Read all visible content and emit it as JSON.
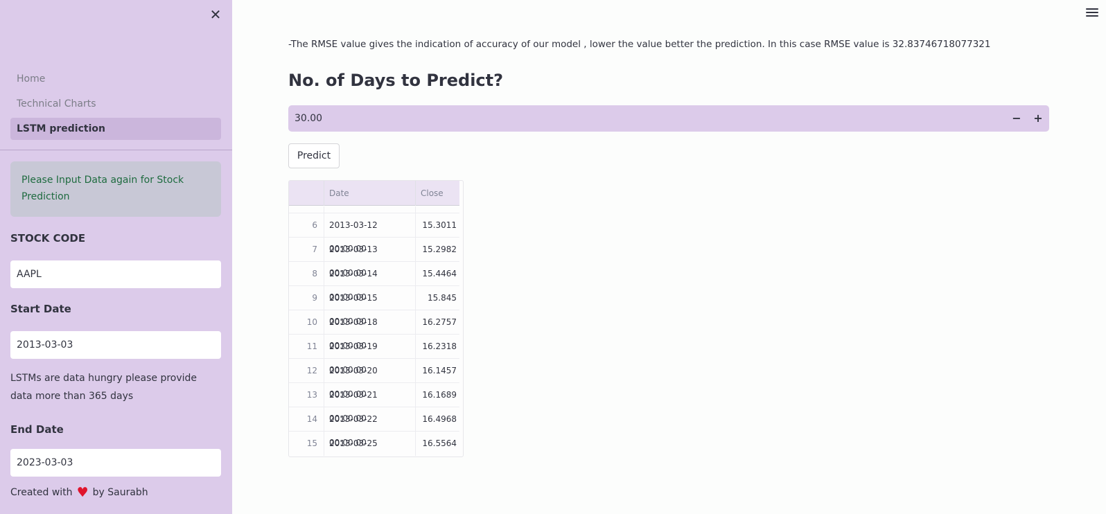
{
  "sidebar": {
    "close_glyph": "✕",
    "nav": [
      "Home",
      "Technical Charts",
      "LSTM prediction"
    ],
    "active_nav": "LSTM prediction",
    "info_message": "Please Input Data again for Stock Prediction",
    "stock_code_label": "STOCK CODE",
    "stock_code_value": "AAPL",
    "start_date_label": "Start Date",
    "start_date_value": "2013-03-03",
    "hint_text": "LSTMs are data hungry please provide data more than 365 days",
    "end_date_label": "End Date",
    "end_date_value": "2023-03-03",
    "credit_prefix": "Created with",
    "credit_suffix": "by Saurabh",
    "credit_icon": "heart-icon"
  },
  "main": {
    "rmse_text": "-The RMSE value gives the indication of accuracy of our model , lower the value better the prediction. In this case RMSE value is 32.83746718077321",
    "heading": "No. of Days to Predict?",
    "days_value": "30.00",
    "minus_glyph": "−",
    "plus_glyph": "+",
    "predict_label": "Predict",
    "table": {
      "columns": [
        "Date",
        "Close"
      ],
      "rows": [
        {
          "index": "6",
          "date": "2013-03-12 00:00:00",
          "close": "15.3011"
        },
        {
          "index": "7",
          "date": "2013-03-13 00:00:00",
          "close": "15.2982"
        },
        {
          "index": "8",
          "date": "2013-03-14 00:00:00",
          "close": "15.4464"
        },
        {
          "index": "9",
          "date": "2013-03-15 00:00:00",
          "close": "15.845"
        },
        {
          "index": "10",
          "date": "2013-03-18 00:00:00",
          "close": "16.2757"
        },
        {
          "index": "11",
          "date": "2013-03-19 00:00:00",
          "close": "16.2318"
        },
        {
          "index": "12",
          "date": "2013-03-20 00:00:00",
          "close": "16.1457"
        },
        {
          "index": "13",
          "date": "2013-03-21 00:00:00",
          "close": "16.1689"
        },
        {
          "index": "14",
          "date": "2013-03-22 00:00:00",
          "close": "16.4968"
        },
        {
          "index": "15",
          "date": "2013-03-25 00:00:00",
          "close": "16.5564"
        }
      ]
    }
  }
}
